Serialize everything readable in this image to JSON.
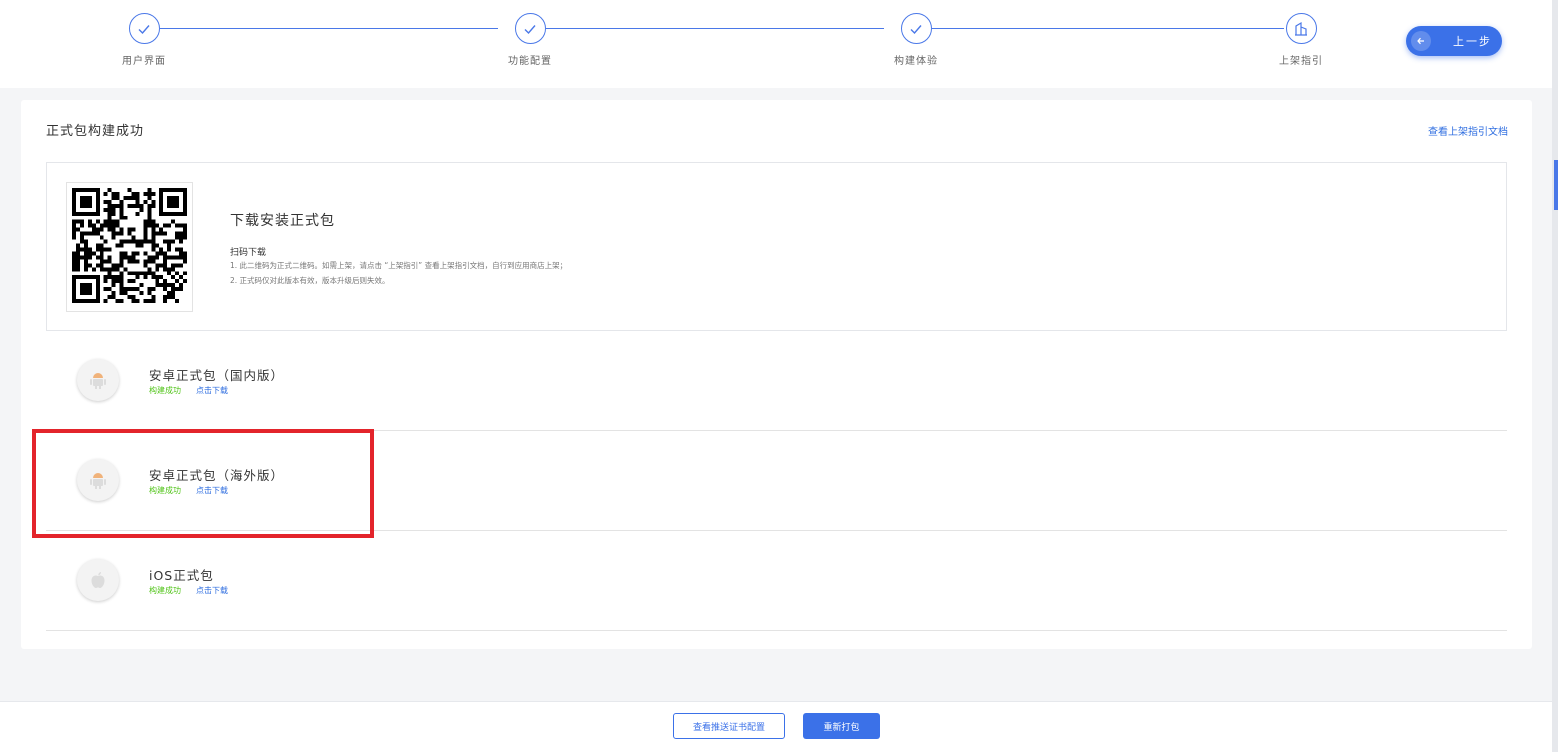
{
  "stepper": {
    "steps": [
      {
        "label": "用户界面",
        "status": "done",
        "icon": "check-icon"
      },
      {
        "label": "功能配置",
        "status": "done",
        "icon": "check-icon"
      },
      {
        "label": "构建体验",
        "status": "done",
        "icon": "check-icon"
      },
      {
        "label": "上架指引",
        "status": "current",
        "icon": "building-icon"
      }
    ],
    "prev_button": "上一步"
  },
  "card": {
    "title": "正式包构建成功",
    "guide_link": "查看上架指引文档",
    "qr": {
      "heading": "下载安装正式包",
      "sub": "扫码下载",
      "notes": [
        "1. 此二维码为正式二维码。如需上架，请点击 “上架指引” 查看上架指引文档，自行到应用商店上架；",
        "2. 正式码仅对此版本有效，版本升级后则失效。"
      ]
    },
    "packages": [
      {
        "name": "安卓正式包（国内版）",
        "status": "构建成功",
        "download": "点击下载",
        "icon": "android-icon"
      },
      {
        "name": "安卓正式包（海外版）",
        "status": "构建成功",
        "download": "点击下载",
        "icon": "android-icon"
      },
      {
        "name": "iOS正式包",
        "status": "构建成功",
        "download": "点击下载",
        "icon": "apple-icon"
      }
    ]
  },
  "footer": {
    "cert_button": "查看推送证书配置",
    "rebuild_button": "重新打包"
  },
  "colors": {
    "accent": "#3b71e8",
    "success": "#52c41a",
    "highlight": "#e3242b"
  }
}
